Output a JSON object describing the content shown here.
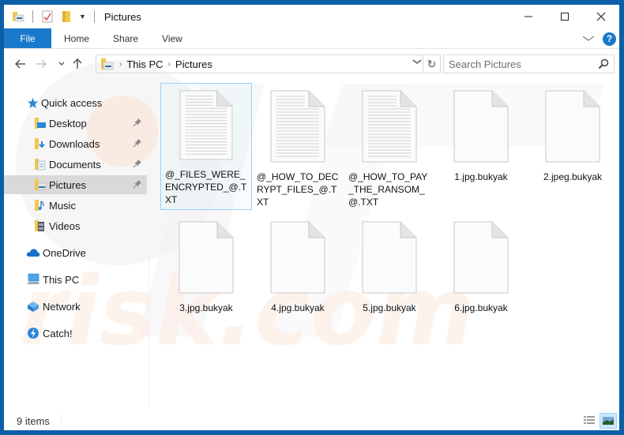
{
  "window": {
    "title": "Pictures",
    "controls": {
      "minimize": "—",
      "maximize": "☐",
      "close": "✕"
    }
  },
  "ribbon": {
    "tabs": [
      {
        "label": "File",
        "active": true
      },
      {
        "label": "Home"
      },
      {
        "label": "Share"
      },
      {
        "label": "View"
      }
    ],
    "expand_icon": "chevron-down",
    "help_label": "?"
  },
  "navigation": {
    "back_icon": "←",
    "forward_icon": "→",
    "recent_icon": "⌄",
    "up_icon": "↑",
    "breadcrumb": [
      "This PC",
      "Pictures"
    ],
    "breadcrumb_separator": "›",
    "dropdown_icon": "⌄",
    "refresh_icon": "↻",
    "search_placeholder": "Search Pictures"
  },
  "sidebar": {
    "items": [
      {
        "label": "Quick access",
        "icon": "star",
        "pinned": false
      },
      {
        "label": "Desktop",
        "icon": "desktop-folder",
        "pinned": true
      },
      {
        "label": "Downloads",
        "icon": "downloads-folder",
        "pinned": true
      },
      {
        "label": "Documents",
        "icon": "documents-folder",
        "pinned": true
      },
      {
        "label": "Pictures",
        "icon": "pictures-folder",
        "pinned": true,
        "selected": true
      },
      {
        "label": "Music",
        "icon": "music-folder",
        "pinned": false
      },
      {
        "label": "Videos",
        "icon": "videos-folder",
        "pinned": false
      },
      {
        "label": "OneDrive",
        "icon": "cloud",
        "pinned": false
      },
      {
        "label": "This PC",
        "icon": "computer",
        "pinned": false
      },
      {
        "label": "Network",
        "icon": "network",
        "pinned": false
      },
      {
        "label": "Catch!",
        "icon": "catch",
        "pinned": false
      }
    ]
  },
  "files": [
    {
      "name": "@_FILES_WERE_ENCRYPTED_@.TXT",
      "type": "text",
      "selected": true
    },
    {
      "name": "@_HOW_TO_DECRYPT_FILES_@.TXT",
      "type": "text"
    },
    {
      "name": "@_HOW_TO_PAY_THE_RANSOM_@.TXT",
      "type": "text"
    },
    {
      "name": "1.jpg.bukyak",
      "type": "blank"
    },
    {
      "name": "2.jpeg.bukyak",
      "type": "blank"
    },
    {
      "name": "3.jpg.bukyak",
      "type": "blank"
    },
    {
      "name": "4.jpg.bukyak",
      "type": "blank"
    },
    {
      "name": "5.jpg.bukyak",
      "type": "blank"
    },
    {
      "name": "6.jpg.bukyak",
      "type": "blank"
    }
  ],
  "status": {
    "item_count": "9 items",
    "views": [
      {
        "name": "details-view",
        "active": false
      },
      {
        "name": "large-icons-view",
        "active": true
      }
    ]
  },
  "colors": {
    "accent": "#1979ca",
    "window_border": "#0b5fa8",
    "selected_sidebar": "#d9d9d9",
    "selection_outline": "#99d1ff"
  }
}
